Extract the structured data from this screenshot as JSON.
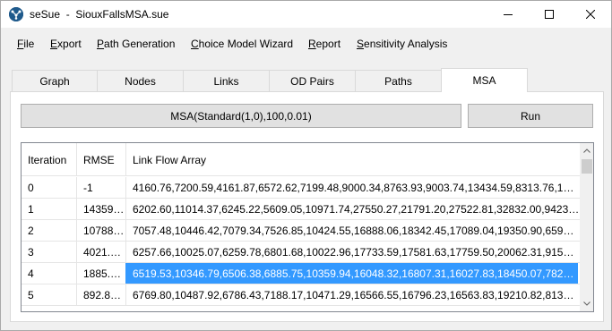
{
  "window": {
    "app_name": "seSue",
    "file_name": "SiouxFallsMSA.sue",
    "icon": "app-network-icon"
  },
  "menu": [
    {
      "label": "File",
      "mnemonic": "F",
      "rest": "ile"
    },
    {
      "label": "Export",
      "mnemonic": "E",
      "rest": "xport"
    },
    {
      "label": "Path Generation",
      "mnemonic": "P",
      "rest": "ath Generation"
    },
    {
      "label": "Choice Model Wizard",
      "mnemonic": "C",
      "rest": "hoice Model Wizard"
    },
    {
      "label": "Report",
      "mnemonic": "R",
      "rest": "eport"
    },
    {
      "label": "Sensitivity Analysis",
      "mnemonic": "S",
      "rest": "ensitivity Analysis"
    }
  ],
  "tabs": [
    {
      "label": "Graph",
      "active": false
    },
    {
      "label": "Nodes",
      "active": false
    },
    {
      "label": "Links",
      "active": false
    },
    {
      "label": "OD Pairs",
      "active": false
    },
    {
      "label": "Paths",
      "active": false
    },
    {
      "label": "MSA",
      "active": true
    }
  ],
  "msa": {
    "config_button": "MSA(Standard(1,0),100,0.01)",
    "run_button": "Run"
  },
  "table": {
    "headers": [
      "Iteration",
      "RMSE",
      "Link Flow Array"
    ],
    "selected_index": 4,
    "rows": [
      {
        "iteration": "0",
        "rmse": "-1",
        "flows": "4160.76,7200.59,4161.87,6572.62,7199.48,9000.34,8763.93,9003.74,13434.59,8313.76,13445.94,9..."
      },
      {
        "iteration": "1",
        "rmse": "14359.6...",
        "flows": "6202.60,11014.37,6245.22,5609.05,10971.74,27550.27,21791.20,27522.81,32832.00,9423.95,3304..."
      },
      {
        "iteration": "2",
        "rmse": "10788.3...",
        "flows": "7057.48,10446.42,7079.34,7526.85,10424.55,16888.06,18342.45,17089.04,19350.90,6595.59,1939..."
      },
      {
        "iteration": "3",
        "rmse": "4021.89...",
        "flows": "6257.66,10025.07,6259.78,6801.68,10022.96,17733.59,17581.63,17759.50,20062.31,9156.86,2007..."
      },
      {
        "iteration": "4",
        "rmse": "1885.00...",
        "flows": "6519.53,10346.79,6506.38,6885.75,10359.94,16048.32,16807.31,16027.83,18450.07,7827.90,1851..."
      },
      {
        "iteration": "5",
        "rmse": "892.842...",
        "flows": "6769.80,10487.92,6786.43,7188.17,10471.29,16566.55,16796.23,16563.83,19210.82,8132.08,1928..."
      }
    ]
  }
}
